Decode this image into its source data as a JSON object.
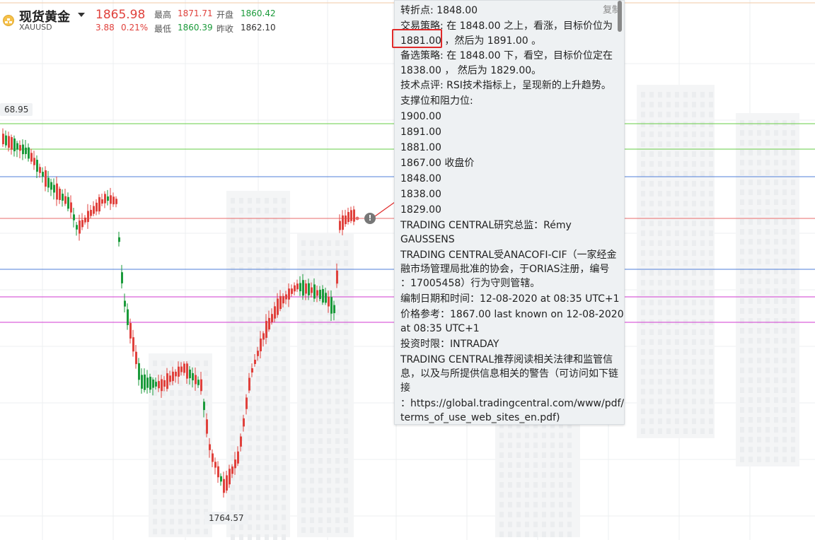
{
  "header": {
    "symbol_name": "现货黄金",
    "symbol_code": "XAUUSD",
    "last_price": "1865.98",
    "change": "3.88",
    "change_pct": "0.21%",
    "high_label": "最高",
    "high_value": "1871.71",
    "low_label": "最低",
    "low_value": "1860.39",
    "open_label": "开盘",
    "open_value": "1860.42",
    "prev_close_label": "昨收",
    "prev_close_value": "1862.10"
  },
  "chart": {
    "left_price_tag": "68.95",
    "bottom_price_tag": "1764.57",
    "colors": {
      "up": "#e0413c",
      "down": "#1a9a3a",
      "line_green": "#66cc44",
      "line_blue": "#4f7fd8",
      "line_red": "#e86b6b",
      "line_magenta": "#d03ad0"
    }
  },
  "popup": {
    "copy_label": "复制",
    "lines": [
      "转折点: 1848.00",
      "交易策略: 在 1848.00 之上，看涨，目标价位为",
      "1881.00 ，然后为 1891.00 。",
      "备选策略: 在 1848.00 下，看空，目标价位定在",
      "1838.00 ， 然后为 1829.00。",
      "技术点评: RSI技术指标上，呈现新的上升趋势。",
      "支撑位和阻力位:",
      "1900.00",
      "1891.00",
      "1881.00",
      "1867.00 收盘价",
      "1848.00",
      "1838.00",
      "1829.00",
      "TRADING CENTRAL研究总监：Rémy",
      "GAUSSENS",
      "TRADING CENTRAL受ANACOFI-CIF（一家经金",
      "融市场管理局批准的协会，于ORIAS注册，编号",
      "：17005458）行为守则管辖。",
      "编制日期和时间：12-08-2020 at 08:35 UTC+1",
      "价格参考：1867.00 last known on 12-08-2020",
      "at 08:35 UTC+1",
      "投资时限：INTRADAY",
      "TRADING CENTRAL推荐阅读相关法律和监管信",
      "息，以及与所提供信息相关的警告（可访问如下链",
      "接",
      "：https://global.tradingcentral.com/www/pdf/",
      "terms_of_use_web_sites_en.pdf)"
    ]
  },
  "info_icon": "info-icon"
}
